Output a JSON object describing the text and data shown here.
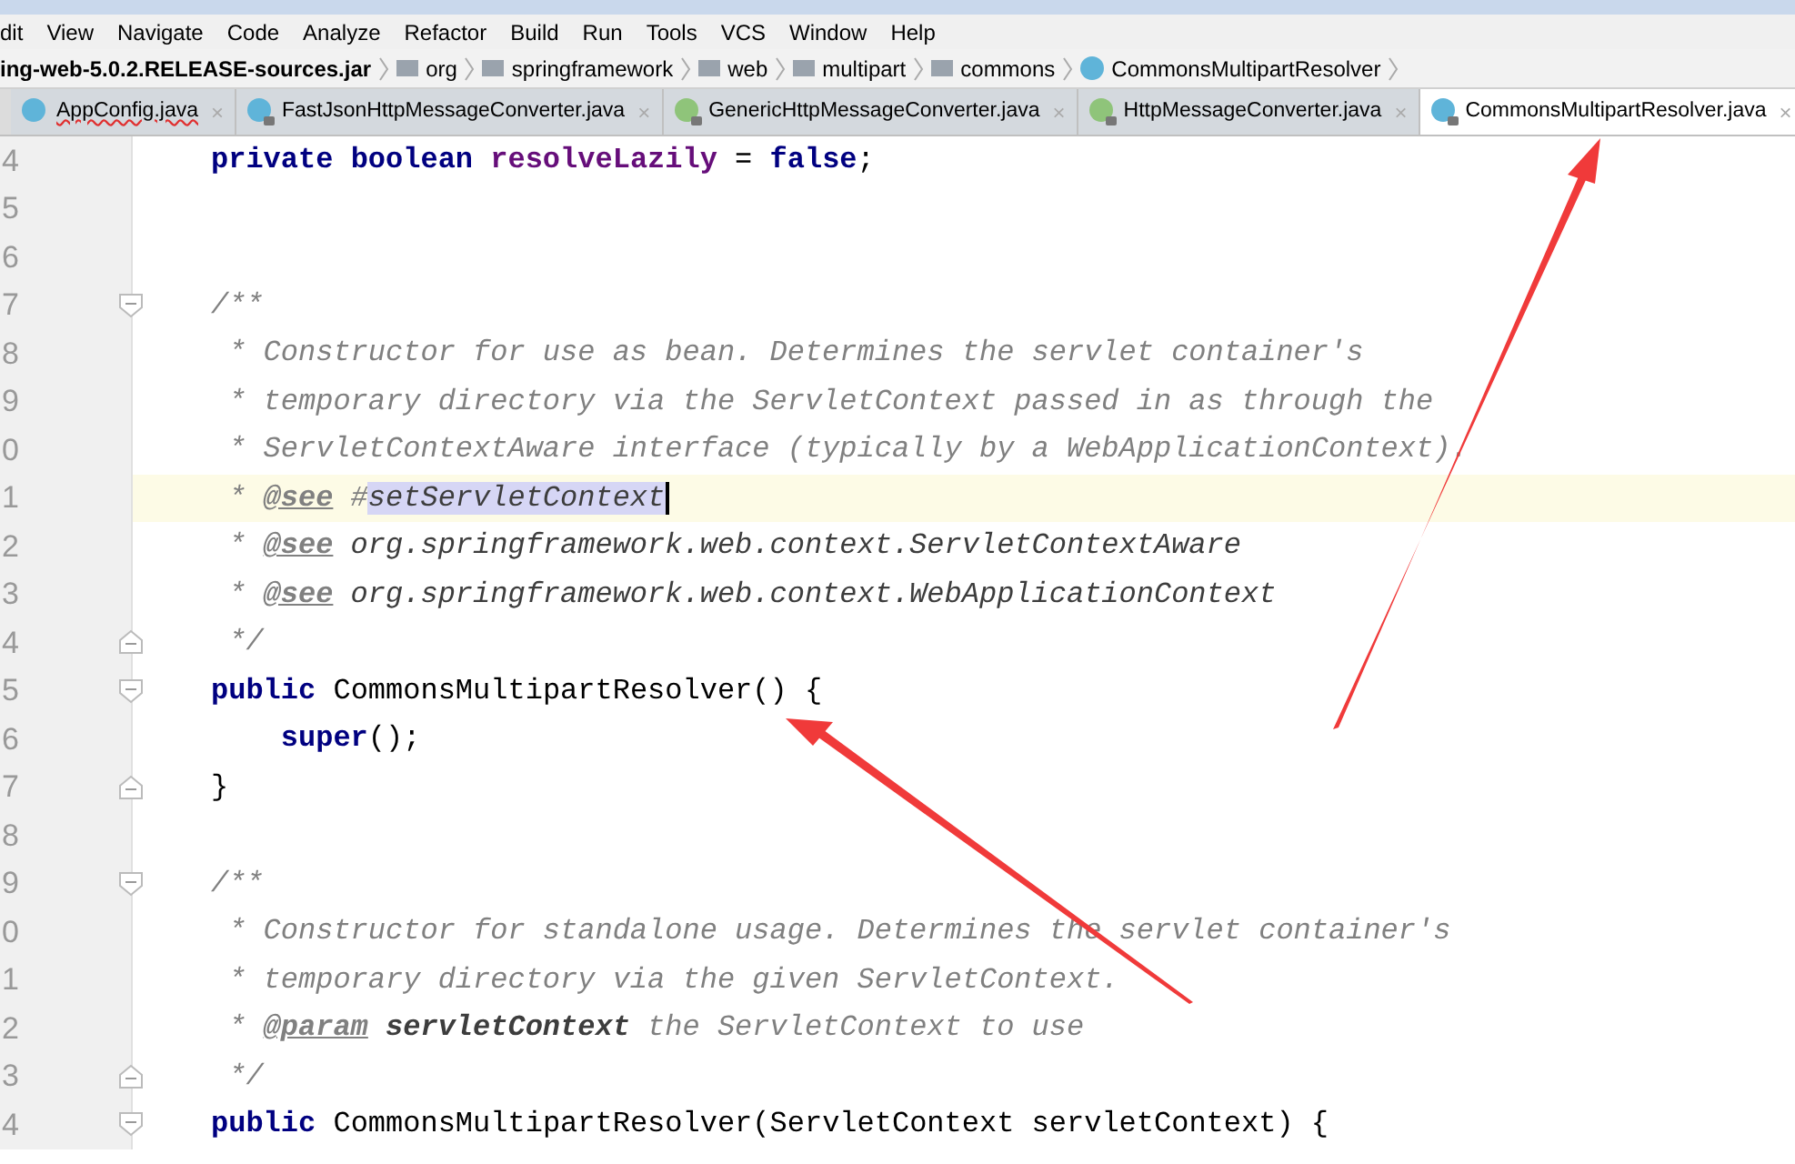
{
  "menu_bar": [
    "dit",
    "View",
    "Navigate",
    "Code",
    "Analyze",
    "Refactor",
    "Build",
    "Run",
    "Tools",
    "VCS",
    "Window",
    "Help"
  ],
  "breadcrumbs": [
    {
      "label": "ing-web-5.0.2.RELEASE-sources.jar",
      "kind": "jar"
    },
    {
      "label": "org",
      "kind": "folder"
    },
    {
      "label": "springframework",
      "kind": "folder"
    },
    {
      "label": "web",
      "kind": "folder"
    },
    {
      "label": "multipart",
      "kind": "folder"
    },
    {
      "label": "commons",
      "kind": "folder"
    },
    {
      "label": "CommonsMultipartResolver",
      "kind": "class"
    }
  ],
  "tabs": [
    {
      "label": "AppConfig.java",
      "kind": "class",
      "locked": false,
      "error": true,
      "selected": false,
      "close": "×"
    },
    {
      "label": "FastJsonHttpMessageConverter.java",
      "kind": "class",
      "locked": true,
      "error": false,
      "selected": false,
      "close": "×"
    },
    {
      "label": "GenericHttpMessageConverter.java",
      "kind": "interface",
      "locked": true,
      "error": false,
      "selected": false,
      "close": "×"
    },
    {
      "label": "HttpMessageConverter.java",
      "kind": "interface",
      "locked": true,
      "error": false,
      "selected": false,
      "close": "×"
    },
    {
      "label": "CommonsMultipartResolver.java",
      "kind": "class",
      "locked": true,
      "error": false,
      "selected": true,
      "close": "×"
    }
  ],
  "editor": {
    "lines": [
      {
        "number": "4",
        "kind": "member",
        "fold_start": false,
        "fold_end": false,
        "current": false,
        "tokens": [
          {
            "kind": "keyword",
            "text": "private boolean "
          },
          {
            "kind": "field",
            "text": "resolveLazily"
          },
          {
            "kind": "plain",
            "text": " = "
          },
          {
            "kind": "keyword",
            "text": "false"
          },
          {
            "kind": "plain",
            "text": ";"
          }
        ]
      },
      {
        "number": "5",
        "kind": "blank",
        "fold_start": false,
        "fold_end": false,
        "current": false
      },
      {
        "number": "6",
        "kind": "blank",
        "fold_start": false,
        "fold_end": false,
        "current": false
      },
      {
        "number": "7",
        "kind": "member",
        "fold_start": true,
        "fold_end": false,
        "current": false,
        "tokens": [
          {
            "kind": "comment",
            "text": "/**"
          }
        ]
      },
      {
        "number": "8",
        "kind": "doc",
        "fold_start": false,
        "fold_end": false,
        "current": false,
        "tokens": [
          {
            "kind": "comment",
            "text": "* Constructor for use as bean. Determines the servlet container's"
          }
        ]
      },
      {
        "number": "9",
        "kind": "doc",
        "fold_start": false,
        "fold_end": false,
        "current": false,
        "tokens": [
          {
            "kind": "comment",
            "text": "* temporary directory via the ServletContext passed in as through the"
          }
        ]
      },
      {
        "number": "0",
        "kind": "doc",
        "fold_start": false,
        "fold_end": false,
        "current": false,
        "tokens": [
          {
            "kind": "comment",
            "text": "* ServletContextAware interface (typically by a WebApplicationContext)."
          }
        ]
      },
      {
        "number": "1",
        "kind": "doc",
        "fold_start": false,
        "fold_end": false,
        "current": true,
        "tokens": [
          {
            "kind": "comment",
            "text": "* "
          },
          {
            "kind": "doctag",
            "text": "@see"
          },
          {
            "kind": "comment",
            "text": " #"
          },
          {
            "kind": "selection",
            "text": "setServletContext"
          }
        ]
      },
      {
        "number": "2",
        "kind": "doc",
        "fold_start": false,
        "fold_end": false,
        "current": false,
        "tokens": [
          {
            "kind": "comment",
            "text": "* "
          },
          {
            "kind": "doctag",
            "text": "@see"
          },
          {
            "kind": "docref",
            "text": " org.springframework.web.context.ServletContextAware"
          }
        ]
      },
      {
        "number": "3",
        "kind": "doc",
        "fold_start": false,
        "fold_end": false,
        "current": false,
        "tokens": [
          {
            "kind": "comment",
            "text": "* "
          },
          {
            "kind": "doctag",
            "text": "@see"
          },
          {
            "kind": "docref",
            "text": " org.springframework.web.context.WebApplicationContext"
          }
        ]
      },
      {
        "number": "4",
        "kind": "doc",
        "fold_start": false,
        "fold_end": true,
        "current": false,
        "tokens": [
          {
            "kind": "comment",
            "text": "*/"
          }
        ]
      },
      {
        "number": "5",
        "kind": "member",
        "fold_start": true,
        "fold_end": false,
        "current": false,
        "tokens": [
          {
            "kind": "keyword",
            "text": "public "
          },
          {
            "kind": "plain",
            "text": "CommonsMultipartResolver() {"
          }
        ]
      },
      {
        "number": "6",
        "kind": "body",
        "fold_start": false,
        "fold_end": false,
        "current": false,
        "tokens": [
          {
            "kind": "keyword",
            "text": "super"
          },
          {
            "kind": "plain",
            "text": "();"
          }
        ]
      },
      {
        "number": "7",
        "kind": "member",
        "fold_start": false,
        "fold_end": true,
        "current": false,
        "tokens": [
          {
            "kind": "plain",
            "text": "}"
          }
        ]
      },
      {
        "number": "8",
        "kind": "blank",
        "fold_start": false,
        "fold_end": false,
        "current": false
      },
      {
        "number": "9",
        "kind": "member",
        "fold_start": true,
        "fold_end": false,
        "current": false,
        "tokens": [
          {
            "kind": "comment",
            "text": "/**"
          }
        ]
      },
      {
        "number": "0",
        "kind": "doc",
        "fold_start": false,
        "fold_end": false,
        "current": false,
        "tokens": [
          {
            "kind": "comment",
            "text": "* Constructor for standalone usage. Determines the servlet container's"
          }
        ]
      },
      {
        "number": "1",
        "kind": "doc",
        "fold_start": false,
        "fold_end": false,
        "current": false,
        "tokens": [
          {
            "kind": "comment",
            "text": "* temporary directory via the given ServletContext."
          }
        ]
      },
      {
        "number": "2",
        "kind": "doc",
        "fold_start": false,
        "fold_end": false,
        "current": false,
        "tokens": [
          {
            "kind": "comment",
            "text": "* "
          },
          {
            "kind": "doctag",
            "text": "@param"
          },
          {
            "kind": "docparam",
            "text": " servletContext"
          },
          {
            "kind": "comment",
            "text": " the ServletContext to use"
          }
        ]
      },
      {
        "number": "3",
        "kind": "doc",
        "fold_start": false,
        "fold_end": true,
        "current": false,
        "tokens": [
          {
            "kind": "comment",
            "text": "*/"
          }
        ]
      },
      {
        "number": "4",
        "kind": "member",
        "fold_start": true,
        "fold_end": false,
        "current": false,
        "tokens": [
          {
            "kind": "keyword",
            "text": "public "
          },
          {
            "kind": "plain",
            "text": "CommonsMultipartResolver(ServletContext servletContext) {"
          }
        ]
      }
    ]
  }
}
